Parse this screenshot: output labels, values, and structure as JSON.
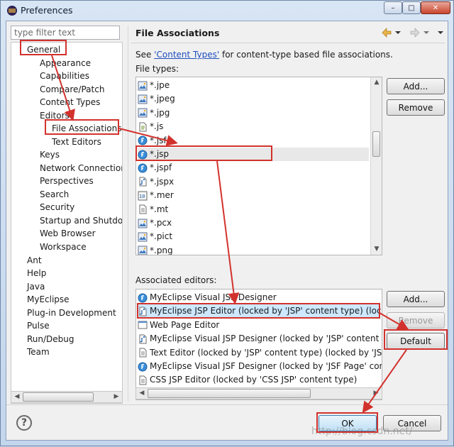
{
  "window": {
    "title": "Preferences",
    "controls": {
      "minimize": "–",
      "maximize": "□",
      "close": "✕"
    }
  },
  "sidebar": {
    "filter_placeholder": "type filter text",
    "items": [
      {
        "label": "General"
      },
      {
        "label": "Appearance"
      },
      {
        "label": "Capabilities"
      },
      {
        "label": "Compare/Patch"
      },
      {
        "label": "Content Types"
      },
      {
        "label": "Editors"
      },
      {
        "label": "File Associations"
      },
      {
        "label": "Text Editors"
      },
      {
        "label": "Keys"
      },
      {
        "label": "Network Connections"
      },
      {
        "label": "Perspectives"
      },
      {
        "label": "Search"
      },
      {
        "label": "Security"
      },
      {
        "label": "Startup and Shutdown"
      },
      {
        "label": "Web Browser"
      },
      {
        "label": "Workspace"
      },
      {
        "label": "Ant"
      },
      {
        "label": "Help"
      },
      {
        "label": "Java"
      },
      {
        "label": "MyEclipse"
      },
      {
        "label": "Plug-in Development"
      },
      {
        "label": "Pulse"
      },
      {
        "label": "Run/Debug"
      },
      {
        "label": "Team"
      }
    ]
  },
  "page": {
    "title": "File Associations",
    "see_prefix": "See ",
    "see_link": "'Content Types'",
    "see_suffix": " for content-type based file associations.",
    "file_types_label": "File types:",
    "file_types": [
      {
        "name": "*.jpe",
        "icon": "image-file-icon"
      },
      {
        "name": "*.jpeg",
        "icon": "image-file-icon"
      },
      {
        "name": "*.jpg",
        "icon": "image-file-icon"
      },
      {
        "name": "*.js",
        "icon": "script-file-icon"
      },
      {
        "name": "*.jsf",
        "icon": "jsf-file-icon"
      },
      {
        "name": "*.jsp",
        "icon": "jsf-file-icon"
      },
      {
        "name": "*.jspf",
        "icon": "jsf-file-icon"
      },
      {
        "name": "*.jspx",
        "icon": "jsp-file-icon"
      },
      {
        "name": "*.mer",
        "icon": "mer-file-icon"
      },
      {
        "name": "*.mt",
        "icon": "text-file-icon"
      },
      {
        "name": "*.pcx",
        "icon": "image-file-icon"
      },
      {
        "name": "*.pict",
        "icon": "image-file-icon"
      },
      {
        "name": "*.png",
        "icon": "image-file-icon"
      }
    ],
    "associated_label": "Associated editors:",
    "editors": [
      {
        "name": "MyEclipse Visual JSF Designer",
        "icon": "jsf-file-icon"
      },
      {
        "name": "MyEclipse JSP Editor (locked by 'JSP' content type) (locked",
        "icon": "jsp-file-icon"
      },
      {
        "name": "Web Page Editor",
        "icon": "web-page-icon"
      },
      {
        "name": "MyEclipse Visual JSP Designer (locked by 'JSP' content type)",
        "icon": "jsp-file-icon"
      },
      {
        "name": "Text Editor (locked by 'JSP' content type) (locked by 'JSF Pa",
        "icon": "text-file-icon"
      },
      {
        "name": "MyEclipse Visual JSF Designer (locked by 'JSF Page' content",
        "icon": "jsf-file-icon"
      },
      {
        "name": "CSS JSP Editor (locked by 'CSS JSP' content type)",
        "icon": "text-file-icon"
      }
    ]
  },
  "buttons": {
    "add_filetype": "Add...",
    "remove_filetype": "Remove",
    "add_editor": "Add...",
    "remove_editor": "Remove",
    "default_editor": "Default",
    "ok": "OK",
    "cancel": "Cancel",
    "help": "?"
  },
  "watermark": "http://blog.csdn.net/",
  "colors": {
    "highlight": "#d2322d",
    "link": "#1e4ebf",
    "selection": "#cde8ff"
  }
}
